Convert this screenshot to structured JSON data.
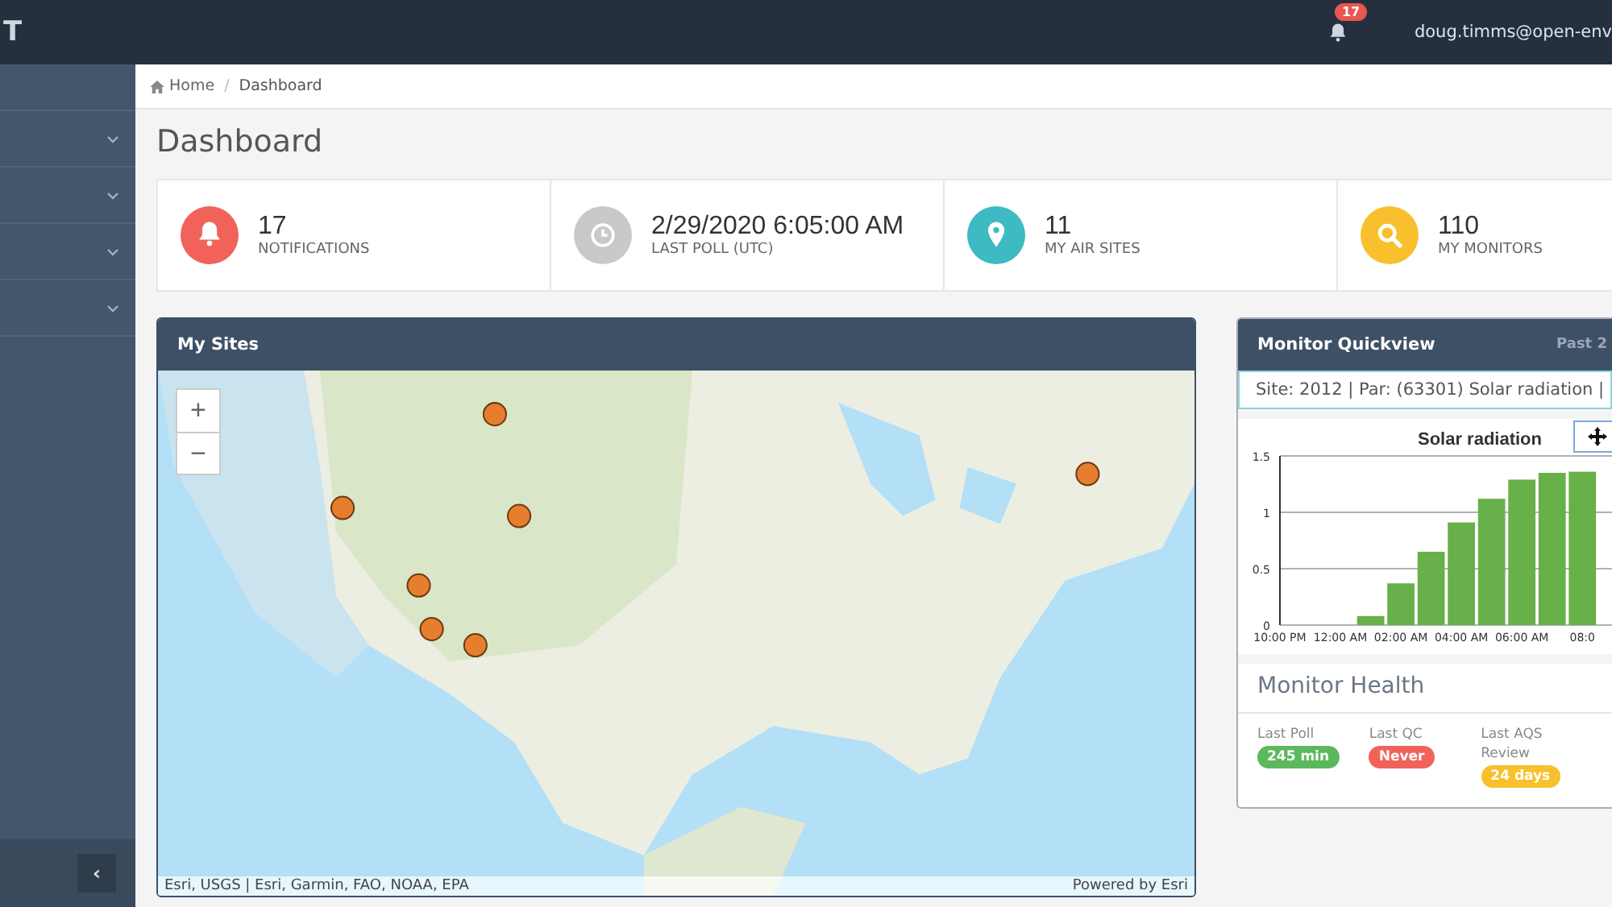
{
  "topbar": {
    "logo": "T",
    "notifications": {
      "count": "17"
    },
    "user": "doug.timms@open-env"
  },
  "sidebar": {
    "items": [
      {
        "expanded": false
      },
      {
        "expanded": false
      },
      {
        "expanded": false
      },
      {
        "expanded": false
      }
    ],
    "collapse": "‹"
  },
  "breadcrumb": {
    "separator": "/",
    "items": [
      {
        "label": "Home",
        "kind": "home"
      },
      {
        "label": "Dashboard",
        "kind": "plain"
      }
    ]
  },
  "page_title": "Dashboard",
  "stats": [
    {
      "kind": "bell",
      "color": "#f0625a",
      "value": "17",
      "label": "NOTIFICATIONS"
    },
    {
      "kind": "clock",
      "color": "#c9c9c9",
      "value": "2/29/2020 6:05:00 AM",
      "label": "LAST POLL (UTC)"
    },
    {
      "kind": "pin",
      "color": "#3dbac2",
      "value": "11",
      "label": "MY AIR SITES"
    },
    {
      "kind": "search",
      "color": "#f8c02c",
      "value": "110",
      "label": "MY MONITORS"
    }
  ],
  "my_sites": {
    "title": "My Sites",
    "map": {
      "kind": "picture",
      "zoom_in": "+",
      "zoom_out": "−",
      "attribution": "Esri, USGS | Esri, Garmin, FAO, NOAA, EPA",
      "powered_by": "Powered by Esri"
    }
  },
  "quickview": {
    "title": "Monitor Quickview",
    "range": "Past 2",
    "site_info": "Site: 2012 | Par: (63301) Solar radiation |",
    "chart_data": {
      "type": "bar",
      "title": "Solar radiation",
      "categories": [
        "10:00 PM",
        null,
        "12:00 AM",
        null,
        "02:00 AM",
        null,
        "04:00 AM",
        null,
        "06:00 AM",
        null,
        "08:0"
      ],
      "series": [
        {
          "color": "#67b04a",
          "values": [
            null,
            null,
            null,
            0.08,
            0.37,
            0.65,
            0.91,
            1.12,
            1.29,
            1.35,
            1.36
          ]
        }
      ],
      "ylim": [
        0,
        1.5
      ],
      "yticks": [
        0,
        0.5,
        1,
        1.5
      ]
    },
    "health_title": "Monitor Health",
    "health": [
      {
        "label": "Last Poll",
        "value": "245 min",
        "color": "#5cb85c"
      },
      {
        "label": "Last QC",
        "value": "Never",
        "color": "#f0625a"
      },
      {
        "label": "Last AQS Review",
        "value": "24 days",
        "color": "#f8c02c"
      }
    ]
  }
}
